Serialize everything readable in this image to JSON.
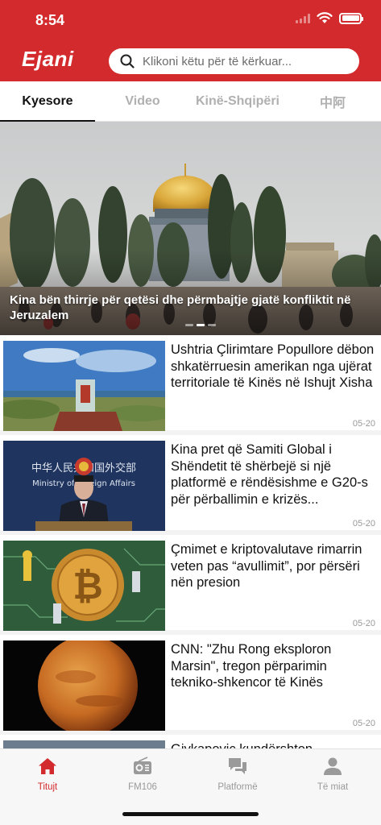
{
  "status_bar": {
    "time": "8:54"
  },
  "header": {
    "logo": "Ejani",
    "search_placeholder": "Klikoni këtu për të kërkuar...",
    "search_icon": "search-icon",
    "brand_color": "#d32a2d"
  },
  "tabs": [
    {
      "label": "Kyesore",
      "active": true
    },
    {
      "label": "Video",
      "active": false
    },
    {
      "label": "Kinë-Shqipëri",
      "active": false
    },
    {
      "label": "中阿",
      "active": false
    }
  ],
  "hero": {
    "caption": "Kina bën thirrje për qetësi dhe përmbajtje gjatë konfliktit në Jeruzalem",
    "slide_count": 3,
    "active_slide": 1
  },
  "news": [
    {
      "title": "Ushtria Çlirimtare Popullore dëbon shkatërruesin amerikan nga ujërat territoriale të Kinës në Ishujt Xisha",
      "date": "05-20"
    },
    {
      "title": "Kina pret që Samiti Global i Shëndetit të shërbejë si një platformë e rëndësishme e G20-s për përballimin e krizës...",
      "date": "05-20"
    },
    {
      "title": "Çmimet e kriptovalutave rimarrin veten pas “avullimit”, por përsëri nën presion",
      "date": "05-20"
    },
    {
      "title": "CNN: \"Zhu Rong eksploron Marsin\", tregon përparimin tekniko-shkencor të Kinës",
      "date": "05-20"
    },
    {
      "title": "Gjykapovic kundërshton",
      "date": ""
    }
  ],
  "thumb_texts": {
    "press_banner_cn": "中华人民共和国外交部",
    "press_banner_en": "Ministry of Foreign Affairs"
  },
  "bottom_nav": [
    {
      "label": "Titujt",
      "icon": "home-icon",
      "active": true
    },
    {
      "label": "FM106",
      "icon": "radio-icon",
      "active": false
    },
    {
      "label": "Platformë",
      "icon": "chat-icon",
      "active": false
    },
    {
      "label": "Të miat",
      "icon": "person-icon",
      "active": false
    }
  ]
}
